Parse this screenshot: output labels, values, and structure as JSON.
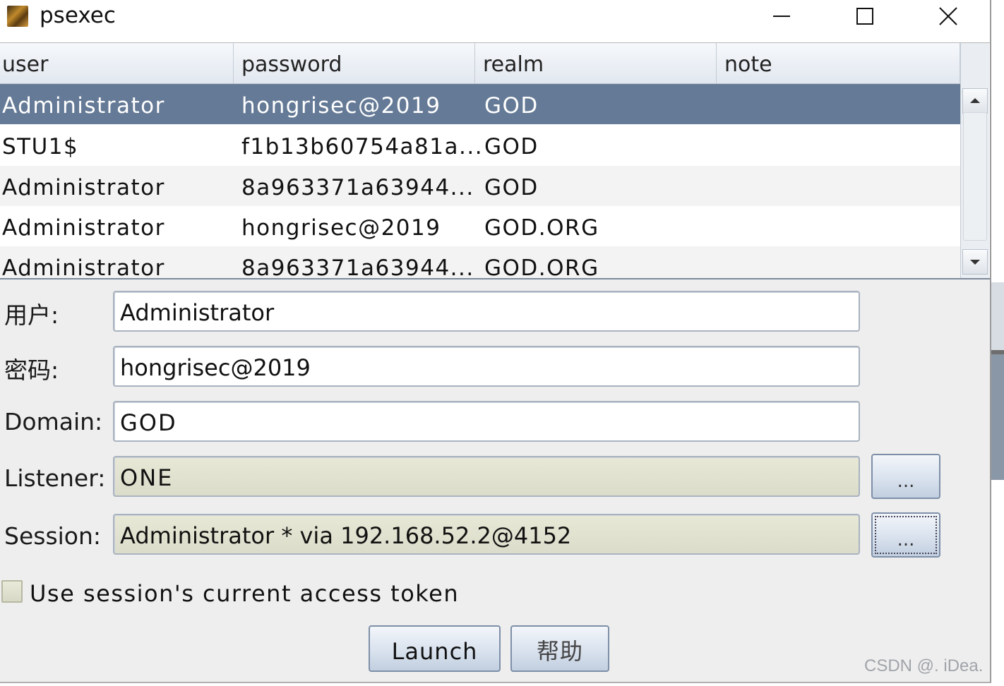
{
  "window": {
    "title": "psexec",
    "icon": "armitage-app-icon",
    "controls": [
      "minimize-icon",
      "maximize-icon",
      "close-icon"
    ]
  },
  "table": {
    "columns": [
      "user",
      "password",
      "realm",
      "note"
    ],
    "rows": [
      {
        "user": "Administrator",
        "password": "hongrisec@2019",
        "realm": "GOD",
        "note": "",
        "selected": true
      },
      {
        "user": "STU1$",
        "password": "f1b13b60754a81a...",
        "realm": "GOD",
        "note": ""
      },
      {
        "user": "Administrator",
        "password": "8a963371a63944...",
        "realm": "GOD",
        "note": ""
      },
      {
        "user": "Administrator",
        "password": "hongrisec@2019",
        "realm": "GOD.ORG",
        "note": ""
      },
      {
        "user": "Administrator",
        "password": "8a963371a63944...",
        "realm": "GOD.ORG",
        "note": ""
      }
    ]
  },
  "form": {
    "user_label": "用户:",
    "user_value": "Administrator",
    "password_label": "密码:",
    "password_value": "hongrisec@2019",
    "domain_label": "Domain:",
    "domain_value": "GOD",
    "listener_label": "Listener:",
    "listener_value": "ONE",
    "listener_browse": "...",
    "session_label": "Session:",
    "session_value": "Administrator * via  192.168.52.2@4152",
    "session_browse": "...",
    "token_checkbox_label": "Use session's current access token",
    "token_checked": false
  },
  "buttons": {
    "launch": "Launch",
    "help": "帮助"
  },
  "watermark": "CSDN @. iDea.",
  "colors": {
    "selection": "#657a96",
    "readonly_field": "#e0e0cf",
    "button_border": "#7d8fa8"
  }
}
